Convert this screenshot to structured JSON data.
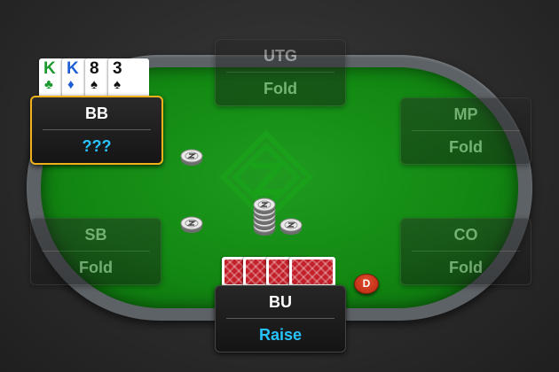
{
  "table": {
    "felt_color": "#138a13",
    "rail_color": "#5d6266",
    "logo_icon": "zoom-logo-icon"
  },
  "hero": {
    "cards": [
      {
        "rank": "K",
        "suit": "♣",
        "suit_name": "clubs"
      },
      {
        "rank": "K",
        "suit": "♦",
        "suit_name": "diamonds"
      },
      {
        "rank": "8",
        "suit": "♠",
        "suit_name": "spades"
      },
      {
        "rank": "3",
        "suit": "♠",
        "suit_name": "spades"
      }
    ]
  },
  "seats": {
    "utg": {
      "position": "UTG",
      "action": "Fold"
    },
    "mp": {
      "position": "MP",
      "action": "Fold"
    },
    "co": {
      "position": "CO",
      "action": "Fold"
    },
    "bu": {
      "position": "BU",
      "action": "Raise"
    },
    "sb": {
      "position": "SB",
      "action": "Fold"
    },
    "bb": {
      "position": "BB",
      "action": "???"
    }
  },
  "dealer_button": {
    "label": "D"
  },
  "colors": {
    "active_border": "#f0b21a",
    "action_blue": "#27c3ff",
    "dealer_red": "#c8321a",
    "card_back_red": "#c4202a"
  }
}
